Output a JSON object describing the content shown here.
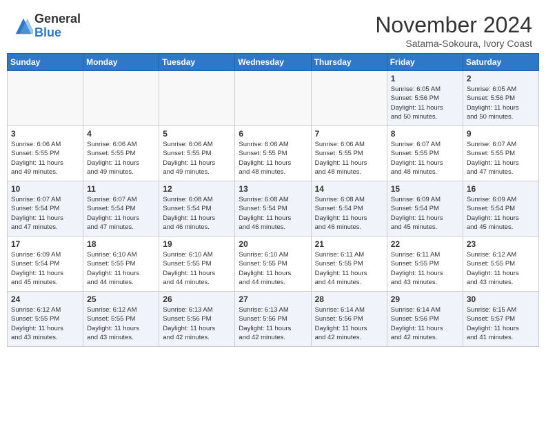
{
  "header": {
    "logo_general": "General",
    "logo_blue": "Blue",
    "month_year": "November 2024",
    "location": "Satama-Sokoura, Ivory Coast"
  },
  "days_of_week": [
    "Sunday",
    "Monday",
    "Tuesday",
    "Wednesday",
    "Thursday",
    "Friday",
    "Saturday"
  ],
  "weeks": [
    [
      {
        "day": "",
        "info": ""
      },
      {
        "day": "",
        "info": ""
      },
      {
        "day": "",
        "info": ""
      },
      {
        "day": "",
        "info": ""
      },
      {
        "day": "",
        "info": ""
      },
      {
        "day": "1",
        "info": "Sunrise: 6:05 AM\nSunset: 5:56 PM\nDaylight: 11 hours\nand 50 minutes."
      },
      {
        "day": "2",
        "info": "Sunrise: 6:05 AM\nSunset: 5:56 PM\nDaylight: 11 hours\nand 50 minutes."
      }
    ],
    [
      {
        "day": "3",
        "info": "Sunrise: 6:06 AM\nSunset: 5:55 PM\nDaylight: 11 hours\nand 49 minutes."
      },
      {
        "day": "4",
        "info": "Sunrise: 6:06 AM\nSunset: 5:55 PM\nDaylight: 11 hours\nand 49 minutes."
      },
      {
        "day": "5",
        "info": "Sunrise: 6:06 AM\nSunset: 5:55 PM\nDaylight: 11 hours\nand 49 minutes."
      },
      {
        "day": "6",
        "info": "Sunrise: 6:06 AM\nSunset: 5:55 PM\nDaylight: 11 hours\nand 48 minutes."
      },
      {
        "day": "7",
        "info": "Sunrise: 6:06 AM\nSunset: 5:55 PM\nDaylight: 11 hours\nand 48 minutes."
      },
      {
        "day": "8",
        "info": "Sunrise: 6:07 AM\nSunset: 5:55 PM\nDaylight: 11 hours\nand 48 minutes."
      },
      {
        "day": "9",
        "info": "Sunrise: 6:07 AM\nSunset: 5:55 PM\nDaylight: 11 hours\nand 47 minutes."
      }
    ],
    [
      {
        "day": "10",
        "info": "Sunrise: 6:07 AM\nSunset: 5:54 PM\nDaylight: 11 hours\nand 47 minutes."
      },
      {
        "day": "11",
        "info": "Sunrise: 6:07 AM\nSunset: 5:54 PM\nDaylight: 11 hours\nand 47 minutes."
      },
      {
        "day": "12",
        "info": "Sunrise: 6:08 AM\nSunset: 5:54 PM\nDaylight: 11 hours\nand 46 minutes."
      },
      {
        "day": "13",
        "info": "Sunrise: 6:08 AM\nSunset: 5:54 PM\nDaylight: 11 hours\nand 46 minutes."
      },
      {
        "day": "14",
        "info": "Sunrise: 6:08 AM\nSunset: 5:54 PM\nDaylight: 11 hours\nand 46 minutes."
      },
      {
        "day": "15",
        "info": "Sunrise: 6:09 AM\nSunset: 5:54 PM\nDaylight: 11 hours\nand 45 minutes."
      },
      {
        "day": "16",
        "info": "Sunrise: 6:09 AM\nSunset: 5:54 PM\nDaylight: 11 hours\nand 45 minutes."
      }
    ],
    [
      {
        "day": "17",
        "info": "Sunrise: 6:09 AM\nSunset: 5:54 PM\nDaylight: 11 hours\nand 45 minutes."
      },
      {
        "day": "18",
        "info": "Sunrise: 6:10 AM\nSunset: 5:55 PM\nDaylight: 11 hours\nand 44 minutes."
      },
      {
        "day": "19",
        "info": "Sunrise: 6:10 AM\nSunset: 5:55 PM\nDaylight: 11 hours\nand 44 minutes."
      },
      {
        "day": "20",
        "info": "Sunrise: 6:10 AM\nSunset: 5:55 PM\nDaylight: 11 hours\nand 44 minutes."
      },
      {
        "day": "21",
        "info": "Sunrise: 6:11 AM\nSunset: 5:55 PM\nDaylight: 11 hours\nand 44 minutes."
      },
      {
        "day": "22",
        "info": "Sunrise: 6:11 AM\nSunset: 5:55 PM\nDaylight: 11 hours\nand 43 minutes."
      },
      {
        "day": "23",
        "info": "Sunrise: 6:12 AM\nSunset: 5:55 PM\nDaylight: 11 hours\nand 43 minutes."
      }
    ],
    [
      {
        "day": "24",
        "info": "Sunrise: 6:12 AM\nSunset: 5:55 PM\nDaylight: 11 hours\nand 43 minutes."
      },
      {
        "day": "25",
        "info": "Sunrise: 6:12 AM\nSunset: 5:55 PM\nDaylight: 11 hours\nand 43 minutes."
      },
      {
        "day": "26",
        "info": "Sunrise: 6:13 AM\nSunset: 5:56 PM\nDaylight: 11 hours\nand 42 minutes."
      },
      {
        "day": "27",
        "info": "Sunrise: 6:13 AM\nSunset: 5:56 PM\nDaylight: 11 hours\nand 42 minutes."
      },
      {
        "day": "28",
        "info": "Sunrise: 6:14 AM\nSunset: 5:56 PM\nDaylight: 11 hours\nand 42 minutes."
      },
      {
        "day": "29",
        "info": "Sunrise: 6:14 AM\nSunset: 5:56 PM\nDaylight: 11 hours\nand 42 minutes."
      },
      {
        "day": "30",
        "info": "Sunrise: 6:15 AM\nSunset: 5:57 PM\nDaylight: 11 hours\nand 41 minutes."
      }
    ]
  ]
}
